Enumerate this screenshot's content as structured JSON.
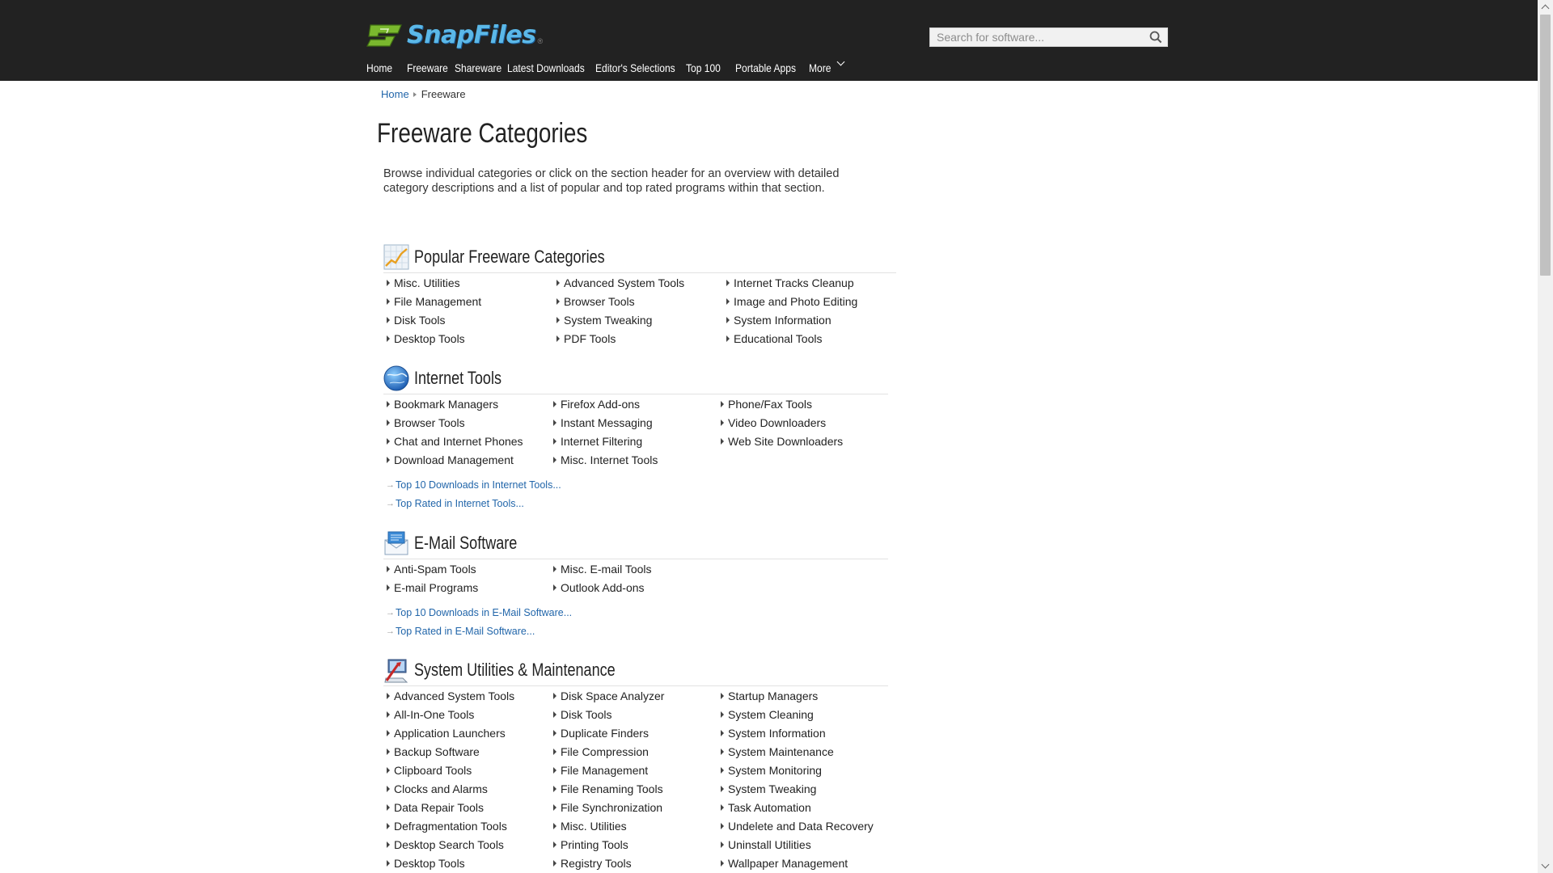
{
  "header": {
    "logo_text": "SnapFiles",
    "logo_mark": "®",
    "search_placeholder": "Search for software...",
    "nav": [
      "Home",
      "Freeware",
      "Shareware",
      "Latest Downloads",
      "Editor's Selections",
      "Top 100",
      "Portable Apps",
      "More"
    ]
  },
  "breadcrumb": {
    "home": "Home",
    "current": "Freeware"
  },
  "page_title": "Freeware Categories",
  "intro": "Browse individual categories or click on the section header for an overview with detailed category descriptions and a list of popular and top rated programs within that section.",
  "sections": [
    {
      "title": "Popular Freeware Categories",
      "icon": "chart-icon",
      "columns": [
        [
          "Misc. Utilities",
          "File Management",
          "Disk Tools",
          "Desktop Tools"
        ],
        [
          "Advanced System Tools",
          "Browser Tools",
          "System Tweaking",
          "PDF Tools"
        ],
        [
          "Internet Tracks Cleanup",
          "Image and Photo Editing",
          "System Information",
          "Educational Tools"
        ]
      ]
    },
    {
      "title": "Internet Tools",
      "icon": "globe-icon",
      "columns": [
        [
          "Bookmark Managers",
          "Browser Tools",
          "Chat and Internet Phones",
          "Download Management"
        ],
        [
          "Firefox Add-ons",
          "Instant Messaging",
          "Internet Filtering",
          "Misc. Internet Tools"
        ],
        [
          "Phone/Fax Tools",
          "Video Downloaders",
          "Web Site Downloaders"
        ]
      ],
      "top_links": [
        "Top 10 Downloads in Internet Tools...",
        "Top Rated in Internet Tools..."
      ]
    },
    {
      "title": "E-Mail Software",
      "icon": "envelope-icon",
      "columns": [
        [
          "Anti-Spam Tools",
          "E-mail Programs"
        ],
        [
          "Misc. E-mail Tools",
          "Outlook Add-ons"
        ],
        []
      ],
      "top_links": [
        "Top 10 Downloads in E-Mail Software...",
        "Top Rated in E-Mail Software..."
      ]
    },
    {
      "title": "System Utilities & Maintenance",
      "icon": "computer-tools-icon",
      "columns": [
        [
          "Advanced System Tools",
          "All-In-One Tools",
          "Application Launchers",
          "Backup Software",
          "Clipboard Tools",
          "Clocks and Alarms",
          "Data Repair Tools",
          "Defragmentation Tools",
          "Desktop Search Tools",
          "Desktop Tools"
        ],
        [
          "Disk Space Analyzer",
          "Disk Tools",
          "Duplicate Finders",
          "File Compression",
          "File Management",
          "File Renaming Tools",
          "File Synchronization",
          "Misc. Utilities",
          "Printing Tools",
          "Registry Tools"
        ],
        [
          "Startup Managers",
          "System Cleaning",
          "System Information",
          "System Maintenance",
          "System Monitoring",
          "System Tweaking",
          "Task Automation",
          "Undelete and Data Recovery",
          "Uninstall Utilities",
          "Wallpaper Management"
        ]
      ]
    }
  ]
}
